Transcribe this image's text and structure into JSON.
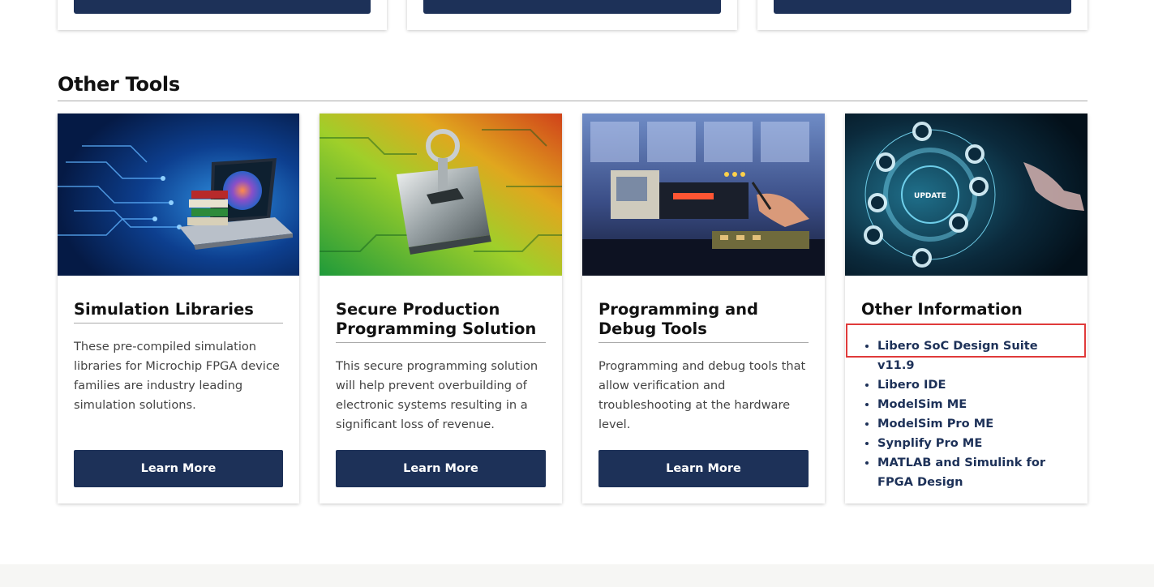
{
  "section": {
    "title": "Other Tools"
  },
  "cards": [
    {
      "title": "Simulation Libraries",
      "description": "These pre-compiled simulation libraries for Microchip FPGA device families are industry leading simulation solutions.",
      "button": "Learn More",
      "image": "laptop-books-circuit-image"
    },
    {
      "title": "Secure Production Programming Solution",
      "description": "This secure programming solution will help prevent overbuilding of electronic systems resulting in a significant loss of revenue.",
      "button": "Learn More",
      "image": "padlock-circuit-image"
    },
    {
      "title": "Programming and Debug Tools",
      "description": "Programming and debug tools that allow verification and troubleshooting at the hardware level.",
      "button": "Learn More",
      "image": "lab-bench-probe-image"
    }
  ],
  "info_card": {
    "title": "Other Information",
    "links": [
      "Libero SoC Design Suite v11.9",
      "Libero IDE",
      "ModelSim ME",
      "ModelSim Pro ME",
      "Synplify Pro ME",
      "MATLAB and Simulink for FPGA Design"
    ],
    "image": "update-hud-image",
    "image_text": "UPDATE"
  },
  "colors": {
    "button_bg": "#1d3158",
    "link": "#1d3158",
    "highlight": "#e03a3a",
    "footer_bg": "#f6f6f4"
  }
}
